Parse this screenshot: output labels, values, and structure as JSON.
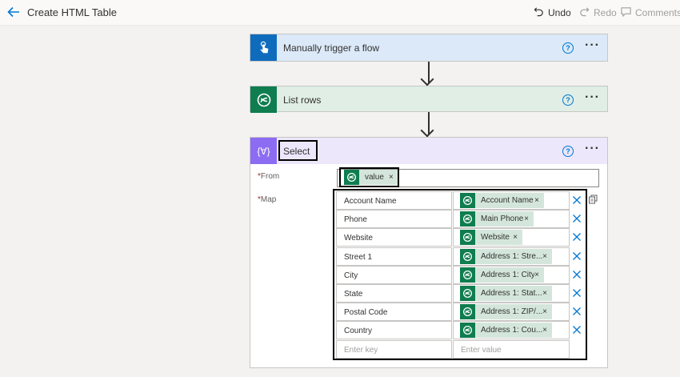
{
  "topbar": {
    "title": "Create HTML Table",
    "undo_label": "Undo",
    "redo_label": "Redo",
    "comments_label": "Comments"
  },
  "cards": {
    "trigger": {
      "title": "Manually trigger a flow",
      "help": "?",
      "more": "···"
    },
    "list_rows": {
      "title": "List rows",
      "help": "?",
      "more": "···"
    },
    "select": {
      "title": "Select",
      "help": "?",
      "more": "···",
      "icon_text": "{∀}"
    }
  },
  "select": {
    "from_label": "From",
    "map_label": "Map",
    "required_mark": "*",
    "from_token": {
      "label": "value",
      "remove": "×"
    },
    "map_rows": [
      {
        "key": "Account Name",
        "value": "Account Name"
      },
      {
        "key": "Phone",
        "value": "Main Phone"
      },
      {
        "key": "Website",
        "value": "Website"
      },
      {
        "key": "Street 1",
        "value": "Address 1: Stre..."
      },
      {
        "key": "City",
        "value": "Address 1: City"
      },
      {
        "key": "State",
        "value": "Address 1: Stat..."
      },
      {
        "key": "Postal Code",
        "value": "Address 1: ZIP/..."
      },
      {
        "key": "Country",
        "value": "Address 1: Cou..."
      }
    ],
    "remove_token": "×",
    "new_row": {
      "key_placeholder": "Enter key",
      "value_placeholder": "Enter value"
    }
  },
  "icons": {
    "back": "arrow-left-icon",
    "undo": "undo-icon",
    "redo": "redo-icon",
    "comments": "comment-icon",
    "trigger": "touch-hand-icon",
    "dataverse": "dataverse-icon",
    "select": "data-operation-icon",
    "delete": "close-icon",
    "switch_mode": "switch-map-mode-icon"
  },
  "colors": {
    "accent": "#0078d4",
    "trigger_bg": "#dbe9f8",
    "trigger_icon_bg": "#0f6cbd",
    "dataverse_bg": "#e0eee5",
    "dataverse_icon_bg": "#0f7d4f",
    "select_header_bg": "#ece7fb",
    "select_icon_bg": "#8c6cf2",
    "token_bg": "#d4e6dc"
  }
}
